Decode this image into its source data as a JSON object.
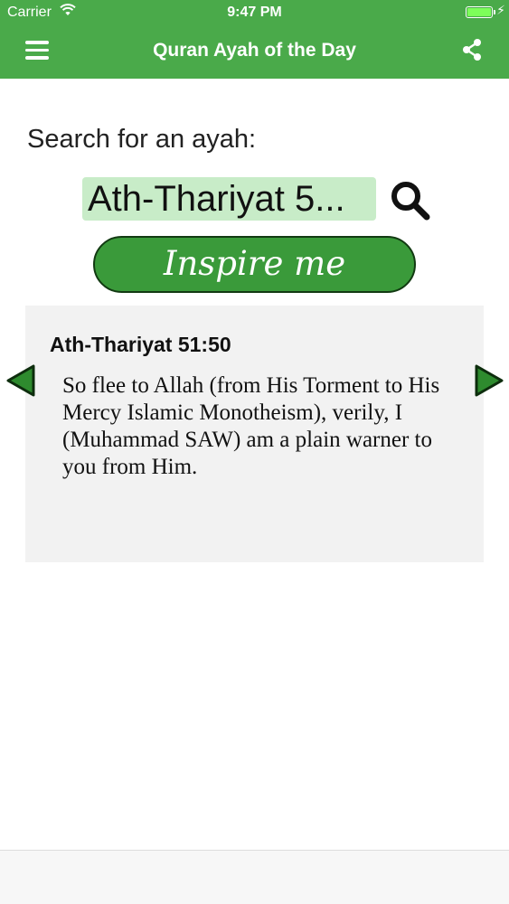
{
  "status_bar": {
    "carrier": "Carrier",
    "time": "9:47 PM",
    "battery_level": 1.0
  },
  "nav_bar": {
    "title": "Quran Ayah of the Day",
    "menu_icon": "hamburger-menu-icon",
    "share_icon": "share-icon"
  },
  "search": {
    "label": "Search for an ayah:",
    "value": "Ath-Thariyat 5...",
    "icon": "search-icon"
  },
  "inspire_button": {
    "label": "Inspire me"
  },
  "ayah": {
    "reference": "Ath-Thariyat 51:50",
    "text": "So flee to Allah (from His Torment to His Mercy Islamic Monotheism), verily, I (Muhammad SAW) am a plain warner to you from Him."
  },
  "navigation": {
    "prev_icon": "triangle-left-icon",
    "next_icon": "triangle-right-icon"
  },
  "colors": {
    "brand_green": "#4aaa4a",
    "button_green": "#3a9a3a",
    "input_bg": "#c8ecc8",
    "arrow_green": "#2e8b2e"
  }
}
